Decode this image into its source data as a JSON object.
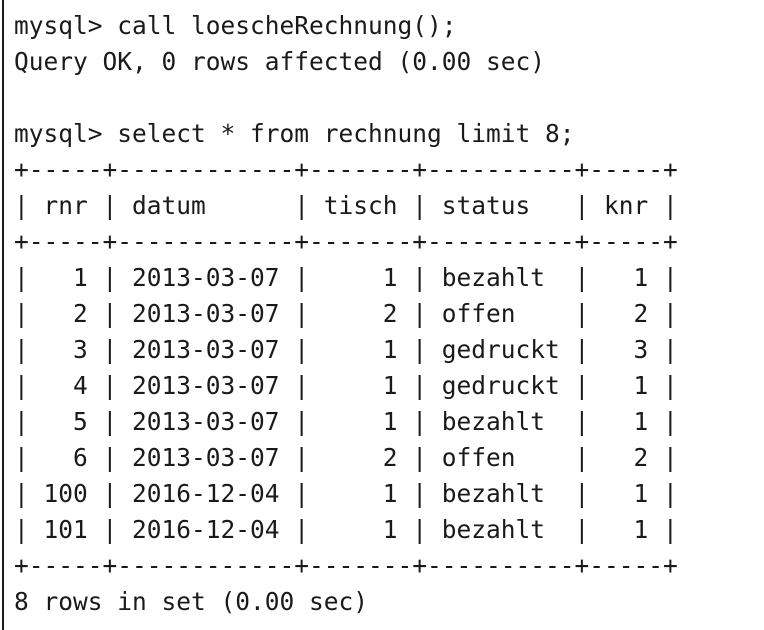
{
  "terminal": {
    "lines": [
      "mysql> call loescheRechnung();",
      "Query OK, 0 rows affected (0.00 sec)",
      "",
      "mysql> select * from rechnung limit 8;",
      "+-----+------------+-------+----------+-----+",
      "| rnr | datum      | tisch | status   | knr |",
      "+-----+------------+-------+----------+-----+",
      "|   1 | 2013-03-07 |     1 | bezahlt  |   1 |",
      "|   2 | 2013-03-07 |     2 | offen    |   2 |",
      "|   3 | 2013-03-07 |     1 | gedruckt |   3 |",
      "|   4 | 2013-03-07 |     1 | gedruckt |   1 |",
      "|   5 | 2013-03-07 |     1 | bezahlt  |   1 |",
      "|   6 | 2013-03-07 |     2 | offen    |   2 |",
      "| 100 | 2016-12-04 |     1 | bezahlt  |   1 |",
      "| 101 | 2016-12-04 |     1 | bezahlt  |   1 |",
      "+-----+------------+-------+----------+-----+",
      "8 rows in set (0.00 sec)"
    ]
  }
}
